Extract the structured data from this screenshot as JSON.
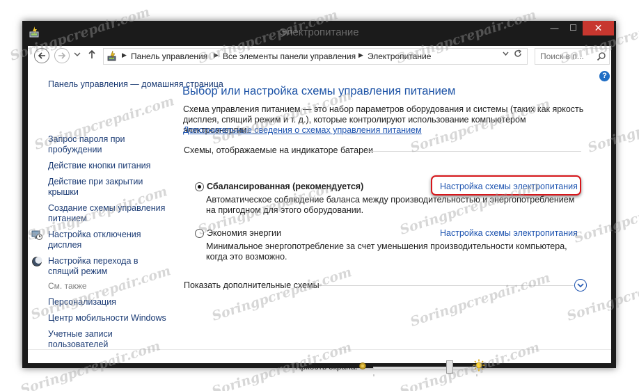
{
  "window": {
    "title": "Электропитание",
    "controls": {
      "minimize": "—",
      "maximize": "☐",
      "close": "✕"
    }
  },
  "address": {
    "breadcrumb": [
      "Панель управления",
      "Все элементы панели управления",
      "Электропитание"
    ],
    "search_placeholder": "Поиск в п..."
  },
  "sidebar": {
    "items": [
      {
        "label": "Панель управления — домашняя страница",
        "icon": null
      },
      {
        "label": "Запрос пароля при пробуждении",
        "icon": null
      },
      {
        "label": "Действие кнопки питания",
        "icon": null
      },
      {
        "label": "Действие при закрытии крышки",
        "icon": null
      },
      {
        "label": "Создание схемы управления питанием",
        "icon": null
      },
      {
        "label": "Настройка отключения дисплея",
        "icon": "display-clock-icon"
      },
      {
        "label": "Настройка перехода в спящий режим",
        "icon": "moon-icon"
      }
    ],
    "see_also_title": "См. также",
    "see_also": [
      {
        "label": "Персонализация"
      },
      {
        "label": "Центр мобильности Windows"
      },
      {
        "label": "Учетные записи пользователей"
      }
    ]
  },
  "main": {
    "heading": "Выбор или настройка схемы управления питанием",
    "description": "Схема управления питанием — это набор параметров оборудования и системы (таких как яркость дисплея, спящий режим и т. д.), которые контролируют использование компьютером электроэнергии.",
    "more_info_link": "Дополнительные сведения о схемах управления питанием",
    "plans_section_label": "Схемы, отображаемые на индикаторе батареи",
    "plans": [
      {
        "name": "Сбалансированная (рекомендуется)",
        "selected": true,
        "description": "Автоматическое соблюдение баланса между производительностью и энергопотреблением на пригодном для этого оборудовании.",
        "link": "Настройка схемы электропитания"
      },
      {
        "name": "Экономия энергии",
        "selected": false,
        "description": "Минимальное энергопотребление за счет уменьшения производительности компьютера, когда это возможно.",
        "link": "Настройка схемы электропитания"
      }
    ],
    "show_more_label": "Показать дополнительные схемы"
  },
  "brightness": {
    "label": "Яркость экрана:",
    "level": 0.75
  },
  "watermark": "Soringpcrepair.com",
  "colors": {
    "title_bar": "#1b1b1b",
    "close_button": "#c7372f",
    "heading": "#1d53a6",
    "link": "#1e54b0",
    "highlight": "#d6161b"
  }
}
